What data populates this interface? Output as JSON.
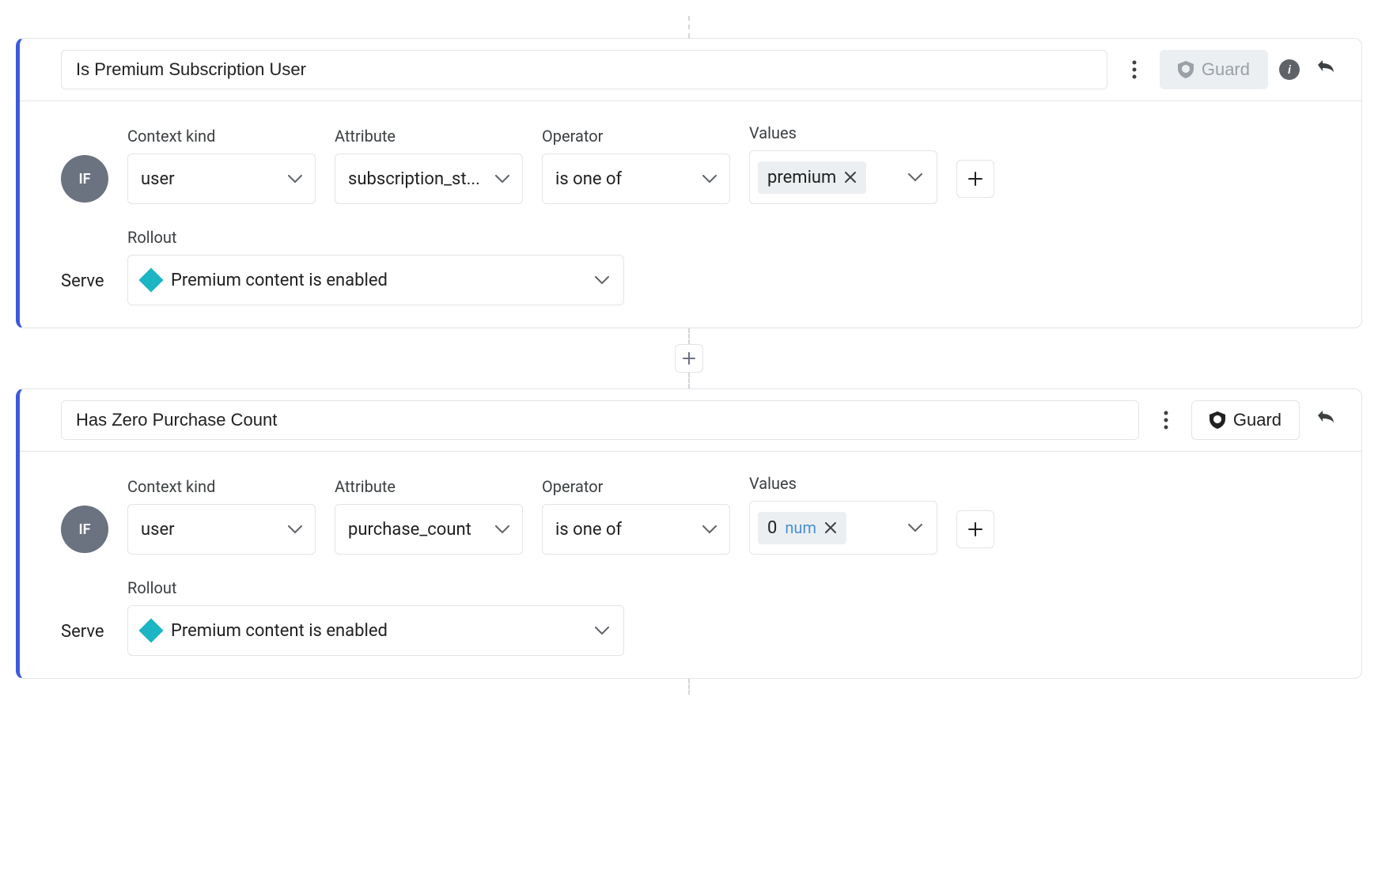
{
  "labels": {
    "if": "IF",
    "serve": "Serve",
    "context_kind": "Context kind",
    "attribute": "Attribute",
    "operator": "Operator",
    "values": "Values",
    "rollout": "Rollout",
    "guard": "Guard",
    "num": "num"
  },
  "rules": [
    {
      "title": "Is Premium Subscription User",
      "guard_disabled": true,
      "show_info": true,
      "clause": {
        "context_kind": "user",
        "attribute": "subscription_st...",
        "operator": "is one of",
        "values": [
          {
            "text": "premium",
            "type": "string"
          }
        ]
      },
      "rollout": "Premium content is enabled"
    },
    {
      "title": "Has Zero Purchase Count",
      "guard_disabled": false,
      "show_info": false,
      "clause": {
        "context_kind": "user",
        "attribute": "purchase_count",
        "operator": "is one of",
        "values": [
          {
            "text": "0",
            "type": "number"
          }
        ]
      },
      "rollout": "Premium content is enabled"
    }
  ]
}
